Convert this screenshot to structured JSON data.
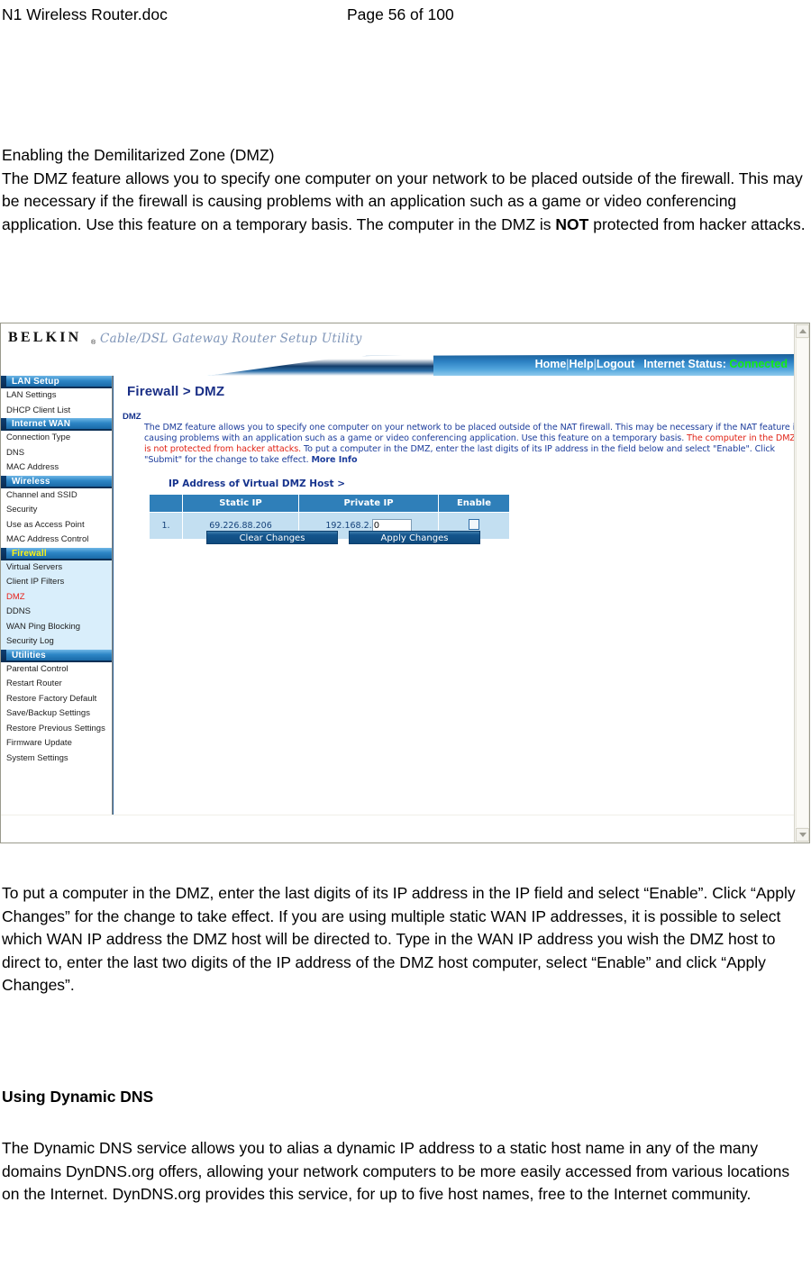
{
  "document": {
    "title": "N1 Wireless Router.doc",
    "page_label": "Page 56 of 100"
  },
  "sections": {
    "dmz_heading": "Enabling the Demilitarized Zone (DMZ)",
    "dmz_paragraph": "The DMZ feature allows you to specify one computer on your network to be placed outside of the firewall. This may be necessary if the firewall is causing problems with an application such as a game or video conferencing application. Use this feature on a temporary basis. The computer in the DMZ is ",
    "dmz_paragraph_bold": "NOT",
    "dmz_paragraph_tail": " protected from hacker attacks.",
    "after_shot_paragraph": "To put a computer in the DMZ, enter the last digits of its IP address in the IP field and select “Enable”. Click “Apply Changes” for the change to take effect. If you are using multiple static WAN IP addresses, it is possible to select which WAN IP address the DMZ host will be directed to. Type in the WAN IP address you wish the DMZ host to direct to, enter the last two digits of the IP address of the DMZ host computer, select “Enable” and click “Apply Changes”.",
    "ddns_heading": "Using Dynamic DNS",
    "ddns_paragraph": "The Dynamic DNS service allows you to alias a dynamic IP address to a static host name in any of the many domains DynDNS.org offers, allowing your network computers to be more easily accessed from various locations on the Internet. DynDNS.org provides this service, for up to five host names, free to the Internet community."
  },
  "router_ui": {
    "brand": "BELKIN",
    "brand_reg": "®",
    "brand_tagline": "Cable/DSL Gateway Router Setup Utility",
    "nav": {
      "home": "Home",
      "help": "Help",
      "logout": "Logout",
      "separator": "|",
      "internet_status_label": "Internet Status:",
      "internet_status_value": "Connected",
      "status_color": "#14ec14"
    },
    "sidebar": {
      "groups": [
        {
          "header": "LAN Setup",
          "active": false,
          "items": [
            {
              "label": "LAN Settings",
              "current": false
            },
            {
              "label": "DHCP Client List",
              "current": false
            }
          ]
        },
        {
          "header": "Internet WAN",
          "active": false,
          "items": [
            {
              "label": "Connection Type",
              "current": false
            },
            {
              "label": "DNS",
              "current": false
            },
            {
              "label": "MAC Address",
              "current": false
            }
          ]
        },
        {
          "header": "Wireless",
          "active": false,
          "items": [
            {
              "label": "Channel and SSID",
              "current": false
            },
            {
              "label": "Security",
              "current": false
            },
            {
              "label": "Use as Access Point",
              "current": false
            },
            {
              "label": "MAC Address Control",
              "current": false
            }
          ]
        },
        {
          "header": "Firewall",
          "active": true,
          "items": [
            {
              "label": "Virtual Servers",
              "current": false
            },
            {
              "label": "Client IP Filters",
              "current": false
            },
            {
              "label": "DMZ",
              "current": true
            },
            {
              "label": "DDNS",
              "current": false
            },
            {
              "label": "WAN Ping Blocking",
              "current": false
            },
            {
              "label": "Security Log",
              "current": false
            }
          ]
        },
        {
          "header": "Utilities",
          "active": false,
          "items": [
            {
              "label": "Parental Control",
              "current": false
            },
            {
              "label": "Restart Router",
              "current": false
            },
            {
              "label": "Restore Factory Default",
              "current": false
            },
            {
              "label": "Save/Backup Settings",
              "current": false
            },
            {
              "label": "Restore Previous Settings",
              "current": false
            },
            {
              "label": "Firmware Update",
              "current": false
            },
            {
              "label": "System Settings",
              "current": false
            }
          ]
        }
      ]
    },
    "content": {
      "page_title": "Firewall > DMZ",
      "section_label": "DMZ",
      "description_part1": "The DMZ feature allows you to specify one computer on your network to be placed outside of the NAT firewall. This may be necessary if the NAT feature is causing problems with an application such as a game or video conferencing application. Use this feature on a temporary basis. ",
      "description_warning": "The computer in the DMZ is not protected from hacker attacks.",
      "description_part2": " To put a computer in the DMZ, enter the last digits of its IP address in the field below and select \"Enable\". Click \"Submit\" for the change to take effect. ",
      "description_more_info": "More Info",
      "table_caption": "IP Address of Virtual DMZ Host >",
      "table": {
        "headers": [
          "",
          "Static IP",
          "Private IP",
          "Enable"
        ],
        "rows": [
          {
            "index": "1.",
            "static_ip": "69.226.88.206",
            "private_ip_prefix": "192.168.2.",
            "private_ip_value": "0",
            "enable_checked": false
          }
        ]
      },
      "buttons": {
        "clear": "Clear Changes",
        "apply": "Apply Changes"
      }
    },
    "scrollbar": {
      "up_icon": "chevron-up-icon",
      "down_icon": "chevron-down-icon"
    }
  }
}
